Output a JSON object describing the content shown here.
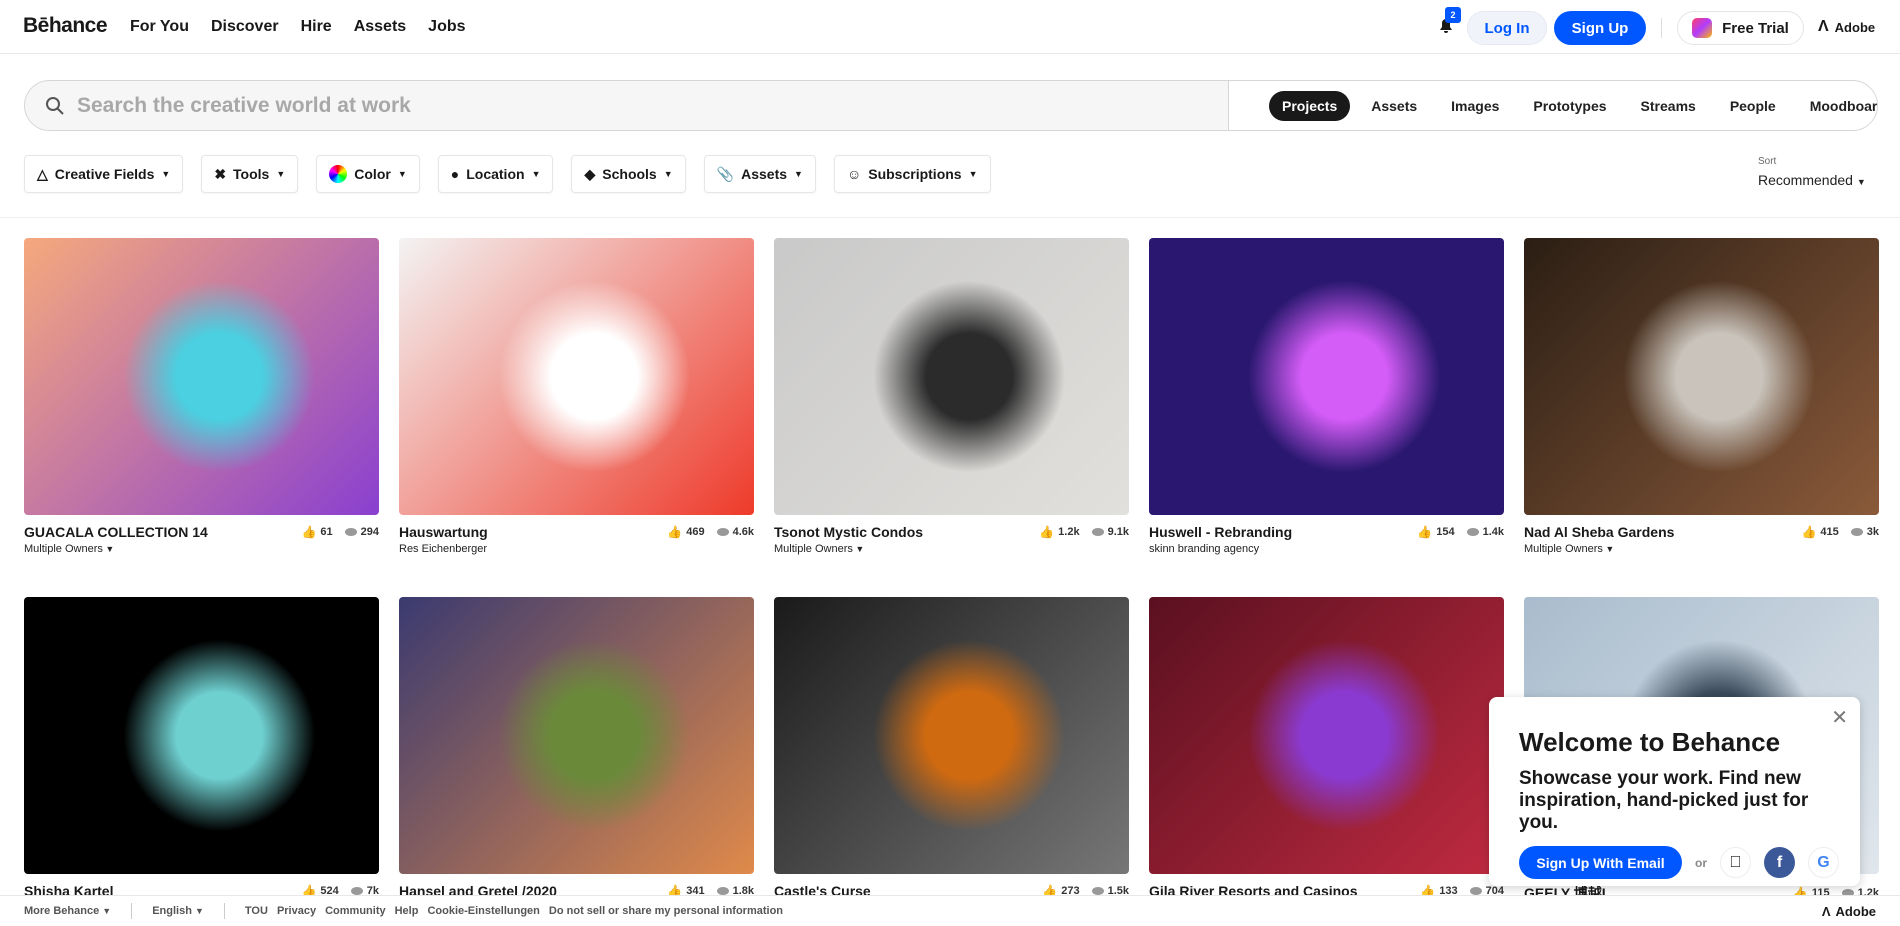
{
  "nav": {
    "logo": "Bēhance",
    "links": [
      "For You",
      "Discover",
      "Hire",
      "Assets",
      "Jobs"
    ],
    "notification_count": "2",
    "login": "Log In",
    "signup": "Sign Up",
    "free_trial": "Free Trial",
    "adobe": "Adobe"
  },
  "search": {
    "placeholder": "Search the creative world at work",
    "tabs": [
      "Projects",
      "Assets",
      "Images",
      "Prototypes",
      "Streams",
      "People",
      "Moodboards"
    ],
    "active_tab": "Projects"
  },
  "filters": [
    {
      "label": "Creative Fields",
      "icon": "creative-fields-icon"
    },
    {
      "label": "Tools",
      "icon": "tools-icon"
    },
    {
      "label": "Color",
      "icon": "color-wheel-icon"
    },
    {
      "label": "Location",
      "icon": "location-pin-icon"
    },
    {
      "label": "Schools",
      "icon": "school-icon"
    },
    {
      "label": "Assets",
      "icon": "paperclip-icon"
    },
    {
      "label": "Subscriptions",
      "icon": "subscriptions-icon"
    }
  ],
  "sort": {
    "label": "Sort",
    "value": "Recommended"
  },
  "projects": [
    {
      "title": "GUACALA COLLECTION 14",
      "owner": "Multiple Owners",
      "owner_dropdown": true,
      "likes": "61",
      "views": "294",
      "colors": [
        "#f6a97c",
        "#8a3fd0",
        "#4ad0e0"
      ]
    },
    {
      "title": "Hauswartung",
      "owner": "Res Eichenberger",
      "owner_dropdown": false,
      "likes": "469",
      "views": "4.6k",
      "colors": [
        "#f3f3f3",
        "#ee3a2a",
        "#fff"
      ]
    },
    {
      "title": "Tsonot Mystic Condos",
      "owner": "Multiple Owners",
      "owner_dropdown": true,
      "likes": "1.2k",
      "views": "9.1k",
      "colors": [
        "#c9c9c9",
        "#e2e0dc",
        "#2b2b2b"
      ]
    },
    {
      "title": "Huswell - Rebranding",
      "owner": "skinn branding agency",
      "owner_dropdown": false,
      "likes": "154",
      "views": "1.4k",
      "colors": [
        "#2a1870",
        "#2a1870",
        "#d45cf7"
      ]
    },
    {
      "title": "Nad Al Sheba Gardens",
      "owner": "Multiple Owners",
      "owner_dropdown": true,
      "likes": "415",
      "views": "3k",
      "colors": [
        "#2b1e14",
        "#8a5a3a",
        "#c9c3bb"
      ]
    },
    {
      "title": "Shisha Kartel",
      "owner": "",
      "owner_dropdown": false,
      "likes": "524",
      "views": "7k",
      "colors": [
        "#000",
        "#000",
        "#6fd0d0"
      ]
    },
    {
      "title": "Hansel and Gretel /2020",
      "owner": "",
      "owner_dropdown": false,
      "likes": "341",
      "views": "1.8k",
      "colors": [
        "#3a3a70",
        "#e08a4a",
        "#6a8a3a"
      ]
    },
    {
      "title": "Castle's Curse",
      "owner": "",
      "owner_dropdown": false,
      "likes": "273",
      "views": "1.5k",
      "colors": [
        "#1a1a1a",
        "#777",
        "#d06a10"
      ]
    },
    {
      "title": "Gila River Resorts and Casinos",
      "owner": "",
      "owner_dropdown": false,
      "likes": "133",
      "views": "704",
      "colors": [
        "#5a1020",
        "#c02a40",
        "#8a3ad0"
      ]
    },
    {
      "title": "GEELY 博越L",
      "owner": "",
      "owner_dropdown": false,
      "likes": "115",
      "views": "1.2k",
      "colors": [
        "#a9bccd",
        "#e0e6ec",
        "#3a4a5a"
      ]
    }
  ],
  "footer": {
    "more": "More Behance",
    "language": "English",
    "links": [
      "TOU",
      "Privacy",
      "Community",
      "Help",
      "Cookie-Einstellungen",
      "Do not sell or share my personal information"
    ],
    "adobe": "Adobe"
  },
  "popup": {
    "title": "Welcome to Behance",
    "text": "Showcase your work. Find new inspiration, hand-picked just for you.",
    "button": "Sign Up With Email",
    "or": "or"
  },
  "colors": {
    "accent": "#0057ff"
  }
}
